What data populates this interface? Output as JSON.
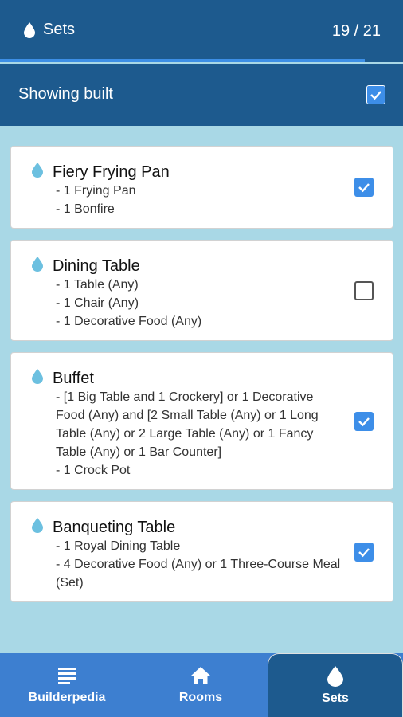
{
  "header": {
    "title": "Sets",
    "counter": "19 / 21",
    "progress": 0.905
  },
  "filter": {
    "label": "Showing built",
    "checked": true
  },
  "sets": [
    {
      "name": "Fiery Frying Pan",
      "requirements": [
        "- 1 Frying Pan",
        "- 1 Bonfire"
      ],
      "built": true
    },
    {
      "name": "Dining Table",
      "requirements": [
        "- 1 Table (Any)",
        "- 1 Chair (Any)",
        "- 1 Decorative Food (Any)"
      ],
      "built": false
    },
    {
      "name": "Buffet",
      "requirements": [
        "- [1 Big Table and 1 Crockery] or 1 Decorative Food (Any) and [2 Small Table (Any) or 1 Long Table (Any) or 2 Large Table (Any) or 1 Fancy Table (Any) or 1 Bar Counter]",
        "- 1 Crock Pot"
      ],
      "built": true
    },
    {
      "name": "Banqueting Table",
      "requirements": [
        "- 1 Royal Dining Table",
        "- 4 Decorative Food (Any) or 1 Three-Course Meal (Set)"
      ],
      "built": true
    }
  ],
  "nav": {
    "items": [
      {
        "label": "Builderpedia",
        "icon": "list-icon"
      },
      {
        "label": "Rooms",
        "icon": "home-icon"
      },
      {
        "label": "Sets",
        "icon": "drop-icon"
      }
    ],
    "active": "Sets"
  },
  "colors": {
    "header_bg": "#1d5a8e",
    "accent": "#3d8ee8",
    "page_bg": "#a9d8e6",
    "drop_icon": "#6cc0e0"
  }
}
